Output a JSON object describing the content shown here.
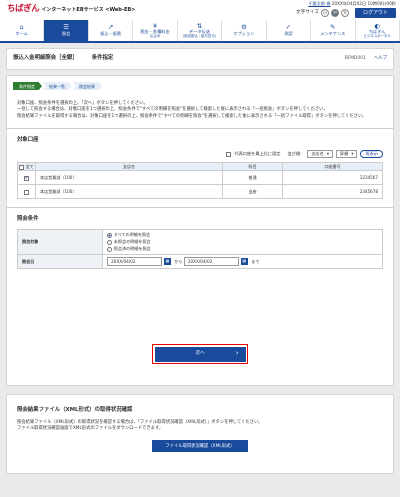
{
  "header": {
    "logo": "ちばぎん",
    "logo_sub": "インターネットEBサービス <Web-EB>",
    "user": "千葉太郎 様",
    "datetime": "20XX年04月02日 10時00分00秒",
    "font_label": "文字サイズ",
    "font_sizes": [
      "小",
      "中",
      "大"
    ],
    "logout": "ログアウト"
  },
  "nav": [
    {
      "icon": "⌂",
      "label": "ホーム"
    },
    {
      "icon": "☰",
      "label": "照会"
    },
    {
      "icon": "↗",
      "label": "振込・振替"
    },
    {
      "icon": "¥",
      "label": "税金・各種料金",
      "sub": "払込み"
    },
    {
      "icon": "⇅",
      "label": "データ伝送",
      "sub": "(総合振込・給与賞与)"
    },
    {
      "icon": "⚙",
      "label": "オプション"
    },
    {
      "icon": "✓",
      "label": "承認"
    },
    {
      "icon": "✎",
      "label": "メンテナンス"
    },
    {
      "icon": "◐",
      "label": "ちばぎん",
      "sub": "ビジネスポータル"
    }
  ],
  "title": {
    "main": "振込入金明細照会［全銀］",
    "sub": "条件指定",
    "code": "BFMD001",
    "help": "ヘルプ"
  },
  "steps": [
    "条件指定",
    "結果一覧",
    "照会結果"
  ],
  "desc": [
    "対象口座、照会条件を選択の上、「次へ」ボタンを押してください。",
    "一括して照会する場合は、対象口座を1つ選択の上、照会条件で\"すべての明細を照会\"を選択して検索した後に表示される「一括照会」ボタンを押してください。",
    "照会結果ファイルを取得する場合は、対象口座を1つ選択の上、照会条件で\"すべての明細を照会\"を選択して検索した後に表示される「一括ファイル取得」ボタンを押してください。"
  ],
  "accounts": {
    "title": "対象口座",
    "rep_label": "代表口座を最上位に固定",
    "sort_label": "並び順：",
    "sort_value": "支店名",
    "order_value": "昇順",
    "redisplay": "再表示",
    "headers": [
      "全て",
      "支店名",
      "科目",
      "口座番号"
    ],
    "rows": [
      {
        "checked": true,
        "branch": "本店営業部（100）",
        "type": "普通",
        "number": "1234567"
      },
      {
        "checked": false,
        "branch": "本店営業部（100）",
        "type": "当座",
        "number": "2345678"
      }
    ]
  },
  "conditions": {
    "title": "照会条件",
    "target_label": "照会対象",
    "options": [
      "すべての明細を照会",
      "未照会の明細を照会",
      "照会済の明細を照会"
    ],
    "date_label": "照会日",
    "date_from": "20XX/04/02",
    "date_to": "20XX/04/02",
    "from_label": "から",
    "to_label": "まで"
  },
  "next": "次へ",
  "xml": {
    "title": "照会結果ファイル（XML形式）の取得状況確認",
    "lines": [
      "照会結果ファイル（XML形式）の取得状況を確認する場合は、「ファイル取得状況確認（XML形式）」ボタンを押してください。",
      "ファイル取得状況確認画面でXML形式のファイルをダウンロードできます。"
    ],
    "button": "ファイル取得状況確認（XML形式）"
  }
}
